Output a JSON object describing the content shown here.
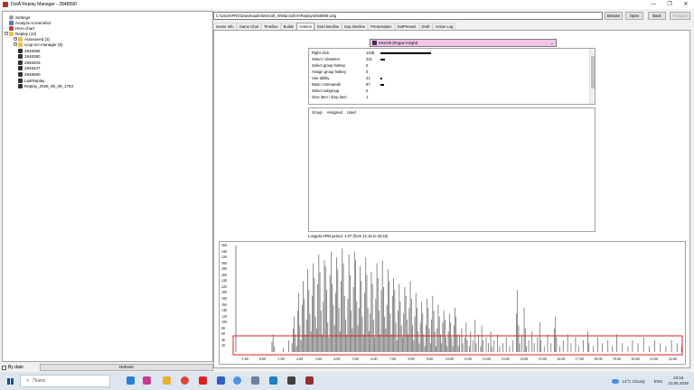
{
  "window": {
    "title": "DotA Replay Manager - 2848590",
    "controls": [
      "—",
      "❐",
      "✕"
    ]
  },
  "tree": {
    "items": [
      {
        "label": "Settings",
        "icon": "gear-icon"
      },
      {
        "label": "Analyze screenshot",
        "icon": "screenshot-icon"
      },
      {
        "label": "Hero chart",
        "icon": "chart-icon"
      },
      {
        "label": "Replay (10)",
        "icon": "folder-icon",
        "expander": "−"
      },
      {
        "label": "Autosaved (3)",
        "icon": "folder-icon",
        "expander": "+"
      },
      {
        "label": "ccup.ncr.manager (8)",
        "icon": "folder-icon",
        "expander": "+"
      },
      {
        "label": "2848386",
        "icon": "replay-icon"
      },
      {
        "label": "2848390",
        "icon": "replay-icon"
      },
      {
        "label": "2848403",
        "icon": "replay-icon"
      },
      {
        "label": "2848437",
        "icon": "replay-icon"
      },
      {
        "label": "2848590",
        "icon": "replay-icon"
      },
      {
        "label": "LastReplay",
        "icon": "replay-icon"
      },
      {
        "label": "Replay_2026_05_09_1753",
        "icon": "replay-icon"
      }
    ]
  },
  "bottom": {
    "checkbox_label": "By date",
    "refresh_label": "Refresh"
  },
  "path": {
    "value": "C:\\Users\\PRO\\Downloads\\Warcraft_III\\Warcraft III\\Replay\\2848590.w3g"
  },
  "toolbar": {
    "browse": "Browse",
    "open": "Open",
    "back": "Back",
    "forward": "Forward"
  },
  "tabs": [
    "Game Info",
    "Game Chat",
    "Timeline",
    "Builds",
    "Actions",
    "Gold timeline",
    "Exp timeline",
    "Presentation",
    "DotPresent",
    "Draft",
    "Action Log"
  ],
  "active_tab": "Actions",
  "player": {
    "selected": "Inker38 (Rogue Knight)"
  },
  "actions": [
    {
      "name": "Right click",
      "value": "1448",
      "fraction": 1.0
    },
    {
      "name": "Select / deselect",
      "value": "221",
      "fraction": 0.15
    },
    {
      "name": "Select group hotkey",
      "value": "0",
      "fraction": 0
    },
    {
      "name": "Assign group hotkey",
      "value": "0",
      "fraction": 0
    },
    {
      "name": "Use ability",
      "value": "41",
      "fraction": 0.03
    },
    {
      "name": "Basic commands",
      "value": "87",
      "fraction": 0.06
    },
    {
      "name": "Select subgroup",
      "value": "0",
      "fraction": 0
    },
    {
      "name": "Give item / drop item",
      "value": "1",
      "fraction": 0.005
    }
  ],
  "groups": {
    "headers": [
      "Group",
      "Assigned",
      "Used"
    ]
  },
  "apm": {
    "longest_period": "Longest APM period: 1:07 (from 21:15 to 22:22)"
  },
  "chart_data": {
    "type": "bar",
    "ylim": [
      0,
      360
    ],
    "yticks": [
      20,
      40,
      60,
      80,
      100,
      120,
      140,
      160,
      180,
      200,
      220,
      240,
      260,
      280,
      300,
      320,
      340,
      360
    ],
    "xticks": [
      "-1:00",
      "0:00",
      "1:00",
      "2:00",
      "3:00",
      "4:00",
      "5:00",
      "6:00",
      "7:00",
      "8:00",
      "9:00",
      "10:00",
      "11:00",
      "12:00",
      "13:00",
      "14:00",
      "15:00",
      "16:00",
      "17:00",
      "18:00",
      "19:00",
      "20:00",
      "21:00",
      "22:00"
    ],
    "x_range_minutes": [
      -1.5,
      22.5
    ],
    "values": [
      0,
      0,
      0,
      0,
      0,
      0,
      0,
      0,
      0,
      0,
      0,
      0,
      0,
      0,
      0,
      0,
      0,
      0,
      0,
      0,
      0,
      0,
      0,
      0,
      0,
      0,
      0,
      0,
      0,
      0,
      0,
      0,
      35,
      60,
      20,
      0,
      0,
      0,
      0,
      0,
      0,
      0,
      15,
      0,
      0,
      0,
      0,
      40,
      0,
      0,
      30,
      80,
      120,
      60,
      20,
      140,
      200,
      90,
      40,
      160,
      240,
      180,
      60,
      110,
      280,
      210,
      130,
      70,
      190,
      300,
      250,
      120,
      80,
      230,
      330,
      270,
      140,
      60,
      170,
      310,
      290,
      210,
      100,
      50,
      260,
      340,
      230,
      160,
      90,
      200,
      320,
      280,
      150,
      70,
      240,
      350,
      300,
      190,
      110,
      60,
      180,
      330,
      260,
      140,
      80,
      220,
      340,
      310,
      170,
      90,
      150,
      290,
      240,
      120,
      60,
      200,
      320,
      260,
      150,
      70,
      130,
      270,
      230,
      110,
      50,
      180,
      300,
      250,
      140,
      60,
      210,
      310,
      220,
      120,
      80,
      160,
      280,
      240,
      130,
      60,
      190,
      250,
      210,
      100,
      40,
      140,
      230,
      170,
      90,
      50,
      130,
      220,
      190,
      110,
      60,
      150,
      240,
      180,
      90,
      40,
      120,
      200,
      150,
      70,
      30,
      100,
      170,
      130,
      60,
      20,
      90,
      180,
      150,
      80,
      30,
      110,
      190,
      140,
      70,
      20,
      80,
      160,
      120,
      60,
      30,
      100,
      140,
      110,
      50,
      20,
      70,
      130,
      100,
      50,
      20,
      90,
      150,
      120,
      60,
      20,
      60,
      0,
      80,
      30,
      0,
      50,
      100,
      40,
      0,
      20,
      70,
      0,
      40,
      0,
      110,
      30,
      0,
      60,
      0,
      20,
      90,
      40,
      0,
      0,
      50,
      0,
      30,
      0,
      70,
      20,
      0,
      40,
      0,
      0,
      60,
      0,
      20,
      0,
      0,
      30,
      0,
      0,
      50,
      0,
      0,
      20,
      0,
      0,
      40,
      0,
      0,
      130,
      210,
      90,
      30,
      0,
      60,
      0,
      150,
      80,
      20,
      0,
      40,
      0,
      0,
      70,
      0,
      30,
      0,
      0,
      50,
      0,
      100,
      40,
      0,
      0,
      20,
      0,
      0,
      60,
      0,
      0,
      30,
      0,
      0,
      80,
      120,
      50,
      0,
      0,
      20,
      0,
      0,
      40,
      0,
      0,
      0,
      60,
      0,
      0,
      30,
      0,
      0,
      0,
      50,
      0,
      0,
      20,
      0,
      0,
      0,
      40,
      0,
      0,
      0,
      70,
      30,
      0,
      0,
      0,
      20,
      0,
      0,
      0,
      50,
      0,
      0,
      0,
      30,
      0,
      0,
      0,
      0,
      40,
      0,
      0,
      0,
      20,
      0,
      0,
      0,
      60,
      0,
      0,
      0,
      0,
      30,
      0,
      0,
      0,
      0,
      20,
      0,
      0,
      0,
      40,
      0,
      0,
      0,
      0,
      30,
      0,
      0,
      0,
      0,
      50,
      0,
      0,
      0,
      0,
      20,
      0,
      0,
      0,
      0,
      40,
      0,
      0,
      0,
      0,
      30,
      0,
      0,
      0,
      0,
      20,
      0,
      0,
      0,
      0,
      40,
      0,
      0,
      0,
      0,
      30,
      0,
      0,
      0,
      20
    ]
  },
  "taskbar": {
    "search_placeholder": "Поиск",
    "weather": "14°C  Cloudy",
    "lang": "ENG",
    "time": "23:16",
    "date": "10.05.2026"
  }
}
